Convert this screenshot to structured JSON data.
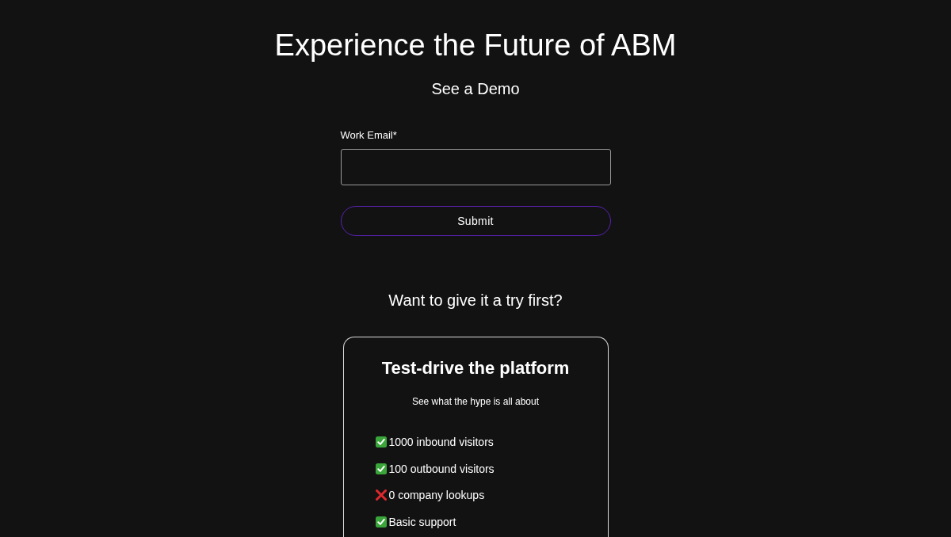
{
  "heading": "Experience the Future of ABM",
  "subheading": "See a Demo",
  "form": {
    "email_field": {
      "label": "Work Email*"
    },
    "submit_button": "Submit"
  },
  "trial_prompt": "Want to give it a try first?",
  "plan_card": {
    "title": "Test-drive the platform",
    "subtitle": "See what the hype is all about",
    "features": [
      {
        "kind": "included",
        "label": "1000 inbound visitors"
      },
      {
        "kind": "included",
        "label": "100 outbound visitors"
      },
      {
        "kind": "excluded",
        "label": "0 company lookups"
      },
      {
        "kind": "included",
        "label": "Basic support"
      }
    ]
  }
}
